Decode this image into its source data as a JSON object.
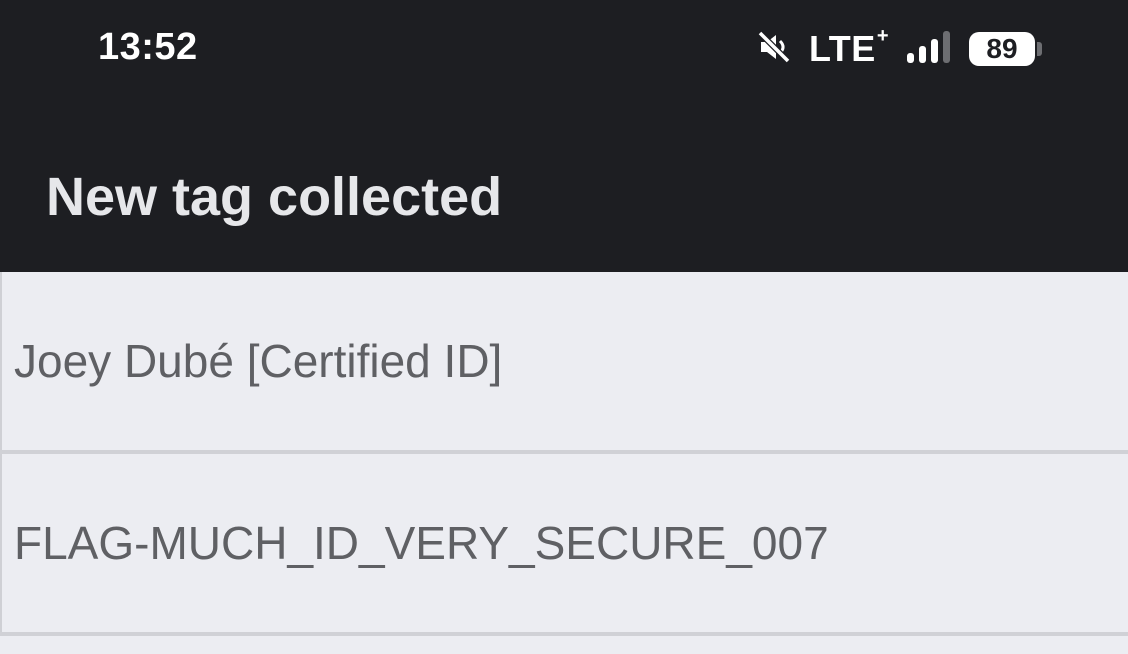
{
  "status_bar": {
    "time": "13:52",
    "network": "LTE",
    "network_suffix": "+",
    "battery": "89",
    "icons": [
      "mute-icon",
      "signal-icon",
      "battery-icon"
    ]
  },
  "app_bar": {
    "title": "New tag collected"
  },
  "list": {
    "items": [
      {
        "label": "Joey Dubé [Certified ID]"
      },
      {
        "label": "FLAG-MUCH_ID_VERY_SECURE_007"
      }
    ]
  },
  "colors": {
    "app_bar_bg": "#1d1e22",
    "content_bg": "#ecedf2",
    "text_secondary": "#5f6064"
  }
}
